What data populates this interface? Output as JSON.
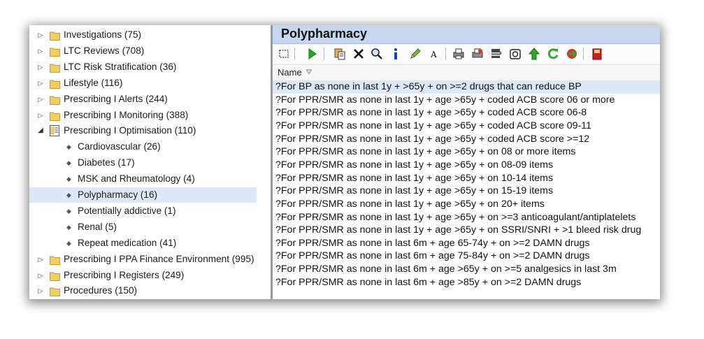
{
  "tree": {
    "items": [
      {
        "label": "Investigations (75)",
        "kind": "folder",
        "expanded": false
      },
      {
        "label": "LTC Reviews (708)",
        "kind": "folder",
        "expanded": false
      },
      {
        "label": "LTC Risk Stratification (36)",
        "kind": "folder",
        "expanded": false
      },
      {
        "label": "Lifestyle (116)",
        "kind": "folder",
        "expanded": false
      },
      {
        "label": "Prescribing I Alerts (244)",
        "kind": "folder",
        "expanded": false
      },
      {
        "label": "Prescribing I Monitoring (388)",
        "kind": "folder",
        "expanded": false
      },
      {
        "label": "Prescribing I Optimisation (110)",
        "kind": "open-folder",
        "expanded": true
      },
      {
        "label": "Cardiovascular (26)",
        "kind": "child"
      },
      {
        "label": "Diabetes (17)",
        "kind": "child"
      },
      {
        "label": "MSK and Rheumatology (4)",
        "kind": "child"
      },
      {
        "label": "Polypharmacy (16)",
        "kind": "child",
        "selected": true
      },
      {
        "label": "Potentially addictive (1)",
        "kind": "child"
      },
      {
        "label": "Renal (5)",
        "kind": "child"
      },
      {
        "label": "Repeat medication (41)",
        "kind": "child"
      },
      {
        "label": "Prescribing I PPA Finance Environment (995)",
        "kind": "folder",
        "expanded": false
      },
      {
        "label": "Prescribing I Registers (249)",
        "kind": "folder",
        "expanded": false
      },
      {
        "label": "Procedures (150)",
        "kind": "folder",
        "expanded": false
      }
    ]
  },
  "panel": {
    "title": "Polypharmacy",
    "column_header": "Name",
    "rows": [
      "?For BP as none in last 1y + >65y + on >=2 drugs that can reduce BP",
      "?For PPR/SMR as none in last 1y + age >65y + coded ACB score 06 or more",
      "?For PPR/SMR as none in last 1y + age >65y + coded ACB score 06-8",
      "?For PPR/SMR as none in last 1y + age >65y + coded ACB score 09-11",
      "?For PPR/SMR as none in last 1y + age >65y + coded ACB score >=12",
      "?For PPR/SMR as none in last 1y + age >65y + on 08 or more items",
      "?For PPR/SMR as none in last 1y + age >65y + on 08-09 items",
      "?For PPR/SMR as none in last 1y + age >65y + on 10-14 items",
      "?For PPR/SMR as none in last 1y + age >65y + on 15-19 items",
      "?For PPR/SMR as none in last 1y + age >65y + on 20+ items",
      "?For PPR/SMR as none in last 1y + age >65y + on >=3 anticoagulant/antiplatelets",
      "?For PPR/SMR as none in last 1y + age >65y + on SSRI/SNRI + >1 bleed risk drug",
      "?For PPR/SMR as none in last 6m + age 65-74y + on >=2 DAMN drugs",
      "?For PPR/SMR as none in last 6m + age 75-84y + on >=2 DAMN drugs",
      "?For PPR/SMR as none in last 6m + age >65y + on >=5 analgesics in last 3m",
      "?For PPR/SMR as none in last 6m + age >85y + on >=2 DAMN drugs"
    ],
    "selected_row": 0
  },
  "toolbar": {
    "icons": [
      "select-box-icon",
      "run-icon",
      "copy-paste-icon",
      "delete-icon",
      "search-icon",
      "info-icon",
      "edit-pencil-icon",
      "font-icon",
      "print-icon",
      "print-preview-icon",
      "export-icon",
      "report-icon",
      "move-up-icon",
      "refresh-icon",
      "navigate-icon",
      "book-icon"
    ]
  },
  "colors": {
    "header_bg": "#c6d6ef",
    "selection_bg": "#dde8f7",
    "folder": "#f2cf63"
  }
}
